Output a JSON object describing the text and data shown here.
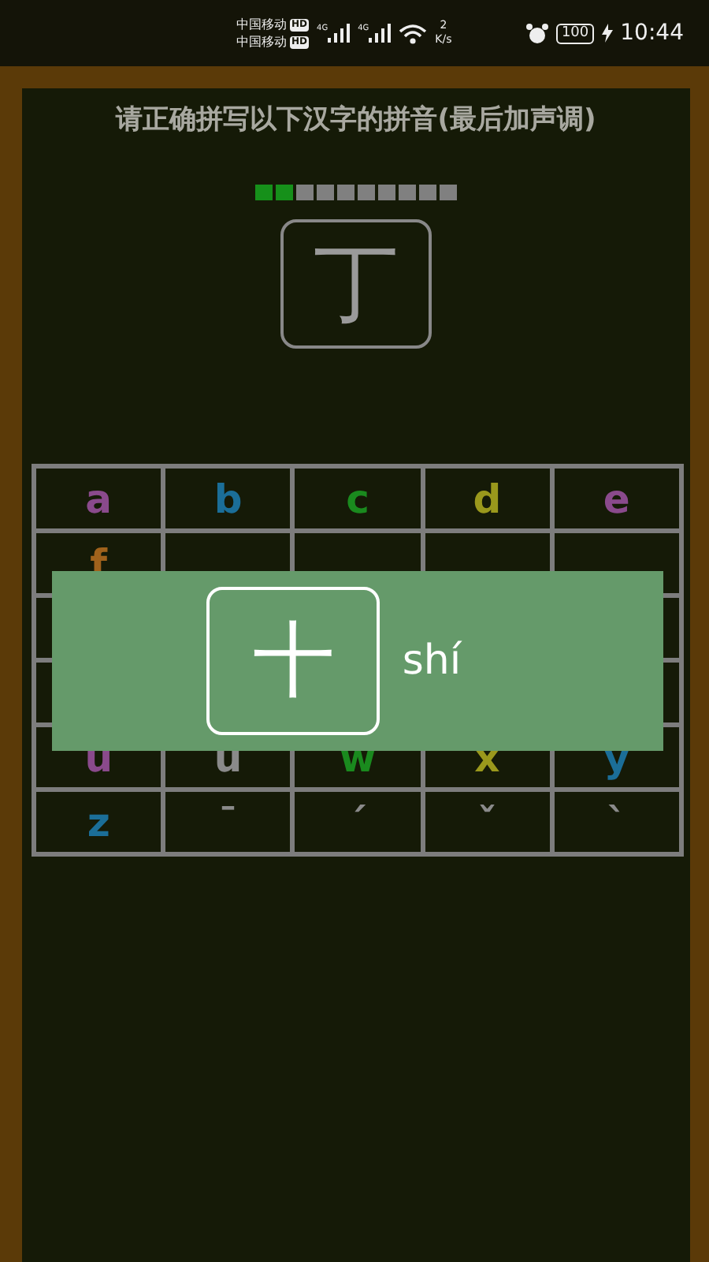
{
  "status_bar": {
    "carriers": [
      {
        "name": "中国移动",
        "badge": "HD",
        "network": "4G"
      },
      {
        "name": "中国移动",
        "badge": "HD",
        "network": "4G"
      }
    ],
    "speed_value": "2",
    "speed_unit": "K/s",
    "battery": "100",
    "time": "10:44"
  },
  "prompt": "请正确拼写以下汉字的拼音(最后加声调)",
  "progress": [
    {
      "correct": true
    },
    {
      "correct": true
    },
    {
      "correct": false
    },
    {
      "correct": false
    },
    {
      "correct": false
    },
    {
      "correct": false
    },
    {
      "correct": false
    },
    {
      "correct": false
    },
    {
      "correct": false
    },
    {
      "correct": false
    }
  ],
  "question_character": "丁",
  "keyboard": [
    [
      {
        "key": "a",
        "color": "#8a4a8c"
      },
      {
        "key": "b",
        "color": "#1b6e98"
      },
      {
        "key": "c",
        "color": "#1a8a1e"
      },
      {
        "key": "d",
        "color": "#9a981c"
      },
      {
        "key": "e",
        "color": "#8a4a8c"
      }
    ],
    [
      {
        "key": "f",
        "color": "#a0621c"
      }
    ],
    [
      {
        "key": "u",
        "color": "#8a4a8c"
      },
      {
        "key": "u",
        "color": "#8a8a8a"
      },
      {
        "key": "w",
        "color": "#1a8a1e"
      },
      {
        "key": "x",
        "color": "#9a981c"
      },
      {
        "key": "y",
        "color": "#1b6e98"
      }
    ],
    [
      {
        "key": "z",
        "color": "#1b6e98"
      },
      {
        "key": "¯",
        "color": "#8a8a8a"
      },
      {
        "key": "´",
        "color": "#8a8a8a"
      },
      {
        "key": "ˇ",
        "color": "#8a8a8a"
      },
      {
        "key": "`",
        "color": "#8a8a8a"
      }
    ]
  ],
  "answer_popup": {
    "character": "十",
    "pinyin": "shí"
  }
}
